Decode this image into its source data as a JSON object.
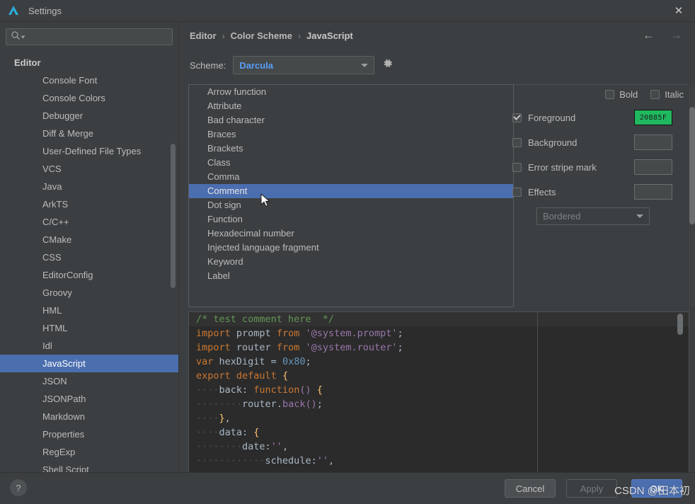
{
  "window": {
    "title": "Settings",
    "logo_icon": "deveco-logo-icon",
    "close_icon": "close-icon"
  },
  "sidebar": {
    "search": {
      "placeholder": "",
      "value": "",
      "icon": "search-icon",
      "dropdown_icon": "chevron-down-icon"
    },
    "root": "Editor",
    "items": [
      {
        "label": "Console Font",
        "selected": false
      },
      {
        "label": "Console Colors",
        "selected": false
      },
      {
        "label": "Debugger",
        "selected": false
      },
      {
        "label": "Diff & Merge",
        "selected": false
      },
      {
        "label": "User-Defined File Types",
        "selected": false
      },
      {
        "label": "VCS",
        "selected": false
      },
      {
        "label": "Java",
        "selected": false
      },
      {
        "label": "ArkTS",
        "selected": false
      },
      {
        "label": "C/C++",
        "selected": false
      },
      {
        "label": "CMake",
        "selected": false
      },
      {
        "label": "CSS",
        "selected": false
      },
      {
        "label": "EditorConfig",
        "selected": false
      },
      {
        "label": "Groovy",
        "selected": false
      },
      {
        "label": "HML",
        "selected": false
      },
      {
        "label": "HTML",
        "selected": false
      },
      {
        "label": "Idl",
        "selected": false
      },
      {
        "label": "JavaScript",
        "selected": true
      },
      {
        "label": "JSON",
        "selected": false
      },
      {
        "label": "JSONPath",
        "selected": false
      },
      {
        "label": "Markdown",
        "selected": false
      },
      {
        "label": "Properties",
        "selected": false
      },
      {
        "label": "RegExp",
        "selected": false
      },
      {
        "label": "Shell Script",
        "selected": false
      }
    ]
  },
  "breadcrumb": {
    "separator": "›",
    "items": [
      "Editor",
      "Color Scheme",
      "JavaScript"
    ]
  },
  "nav": {
    "back_icon": "arrow-left-icon",
    "forward_icon": "arrow-right-icon"
  },
  "scheme": {
    "label": "Scheme:",
    "value": "Darcula",
    "dropdown_icon": "chevron-down-icon",
    "settings_icon": "gear-icon"
  },
  "attribute_list": {
    "items": [
      {
        "label": "Arrow function",
        "selected": false
      },
      {
        "label": "Attribute",
        "selected": false
      },
      {
        "label": "Bad character",
        "selected": false
      },
      {
        "label": "Braces",
        "selected": false
      },
      {
        "label": "Brackets",
        "selected": false
      },
      {
        "label": "Class",
        "selected": false
      },
      {
        "label": "Comma",
        "selected": false
      },
      {
        "label": "Comment",
        "selected": true
      },
      {
        "label": "Dot sign",
        "selected": false
      },
      {
        "label": "Function",
        "selected": false
      },
      {
        "label": "Hexadecimal number",
        "selected": false
      },
      {
        "label": "Injected language fragment",
        "selected": false
      },
      {
        "label": "Keyword",
        "selected": false
      },
      {
        "label": "Label",
        "selected": false
      }
    ]
  },
  "attributes": {
    "bold": {
      "label": "Bold",
      "checked": false
    },
    "italic": {
      "label": "Italic",
      "checked": false
    },
    "foreground": {
      "label": "Foreground",
      "checked": true,
      "color_hex": "20B85F",
      "swatch_text": "20B85F"
    },
    "background": {
      "label": "Background",
      "checked": false,
      "swatch_text": ""
    },
    "error_stripe_mark": {
      "label": "Error stripe mark",
      "checked": false,
      "swatch_text": ""
    },
    "effects": {
      "label": "Effects",
      "checked": false,
      "swatch_text": ""
    },
    "effect_type": {
      "value": "Bordered",
      "dropdown_icon": "chevron-down-icon"
    }
  },
  "preview": {
    "lines": [
      [
        {
          "t": "/* test comment here  */",
          "c": "tok-cmt"
        }
      ],
      [
        {
          "t": "import",
          "c": "tok-kw"
        },
        {
          "t": " prompt ",
          "c": "tok-plain"
        },
        {
          "t": "from",
          "c": "tok-kw"
        },
        {
          "t": " ",
          "c": "tok-plain"
        },
        {
          "t": "'@system.prompt'",
          "c": "tok-purple"
        },
        {
          "t": ";",
          "c": "tok-plain"
        }
      ],
      [
        {
          "t": "import",
          "c": "tok-kw"
        },
        {
          "t": " router ",
          "c": "tok-plain"
        },
        {
          "t": "from",
          "c": "tok-kw"
        },
        {
          "t": " ",
          "c": "tok-plain"
        },
        {
          "t": "'@system.router'",
          "c": "tok-purple"
        },
        {
          "t": ";",
          "c": "tok-plain"
        }
      ],
      [
        {
          "t": "var",
          "c": "tok-kw"
        },
        {
          "t": " hexDigit = ",
          "c": "tok-plain"
        },
        {
          "t": "0x80",
          "c": "tok-num"
        },
        {
          "t": ";",
          "c": "tok-plain"
        }
      ],
      [
        {
          "t": "export",
          "c": "tok-kw"
        },
        {
          "t": " ",
          "c": "tok-plain"
        },
        {
          "t": "default",
          "c": "tok-kw"
        },
        {
          "t": " ",
          "c": "tok-plain"
        },
        {
          "t": "{",
          "c": "tok-fn"
        }
      ],
      [
        {
          "t": "····",
          "c": "tok-ws"
        },
        {
          "t": "back: ",
          "c": "tok-plain"
        },
        {
          "t": "function",
          "c": "tok-kw"
        },
        {
          "t": "()",
          "c": "tok-purple"
        },
        {
          "t": " ",
          "c": "tok-plain"
        },
        {
          "t": "{",
          "c": "tok-fn"
        }
      ],
      [
        {
          "t": "········",
          "c": "tok-ws"
        },
        {
          "t": "router",
          "c": "tok-plain"
        },
        {
          "t": ".",
          "c": "tok-plain"
        },
        {
          "t": "back",
          "c": "tok-meth"
        },
        {
          "t": "()",
          "c": "tok-purple"
        },
        {
          "t": ";",
          "c": "tok-plain"
        }
      ],
      [
        {
          "t": "····",
          "c": "tok-ws"
        },
        {
          "t": "}",
          "c": "tok-fn"
        },
        {
          "t": ",",
          "c": "tok-plain"
        }
      ],
      [
        {
          "t": "····",
          "c": "tok-ws"
        },
        {
          "t": "data: ",
          "c": "tok-plain"
        },
        {
          "t": "{",
          "c": "tok-fn"
        }
      ],
      [
        {
          "t": "········",
          "c": "tok-ws"
        },
        {
          "t": "date:",
          "c": "tok-plain"
        },
        {
          "t": "''",
          "c": "tok-purple"
        },
        {
          "t": ",",
          "c": "tok-plain"
        }
      ],
      [
        {
          "t": "············",
          "c": "tok-ws"
        },
        {
          "t": "schedule:",
          "c": "tok-plain"
        },
        {
          "t": "''",
          "c": "tok-purple"
        },
        {
          "t": ",",
          "c": "tok-plain"
        }
      ]
    ]
  },
  "footer": {
    "help_label": "?",
    "cancel_label": "Cancel",
    "apply_label": "Apply",
    "ok_label": "OK"
  },
  "watermark": {
    "text": "CSDN @田本初"
  }
}
